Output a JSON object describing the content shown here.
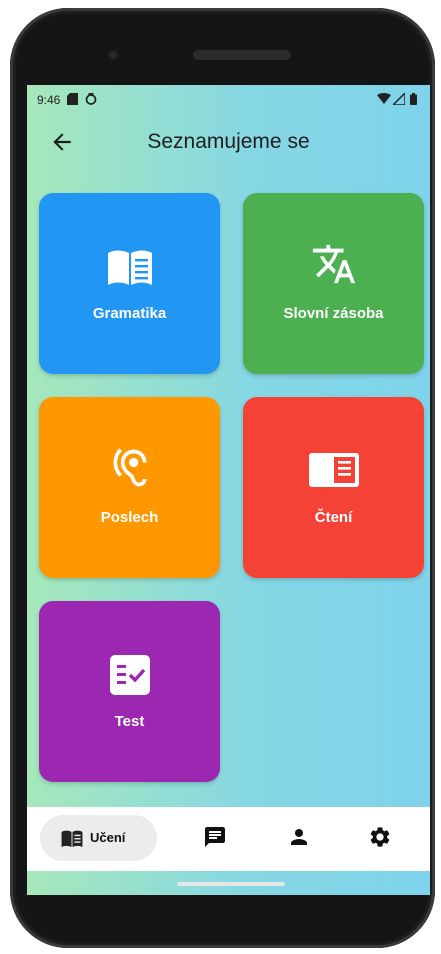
{
  "status_bar": {
    "time": "9:46"
  },
  "header": {
    "title": "Seznamujeme se"
  },
  "tiles": [
    {
      "label": "Gramatika",
      "color": "#2196f3",
      "icon": "book-icon"
    },
    {
      "label": "Slovní zásoba",
      "color": "#4caf50",
      "icon": "translate-icon"
    },
    {
      "label": "Poslech",
      "color": "#ff9800",
      "icon": "hearing-icon"
    },
    {
      "label": "Čtení",
      "color": "#f44336",
      "icon": "chrome-reader-icon"
    },
    {
      "label": "Test",
      "color": "#9c27b0",
      "icon": "checklist-icon"
    }
  ],
  "bottom_nav": {
    "active_label": "Učení",
    "items": [
      "book-icon",
      "chat-icon",
      "person-icon",
      "settings-icon"
    ]
  }
}
